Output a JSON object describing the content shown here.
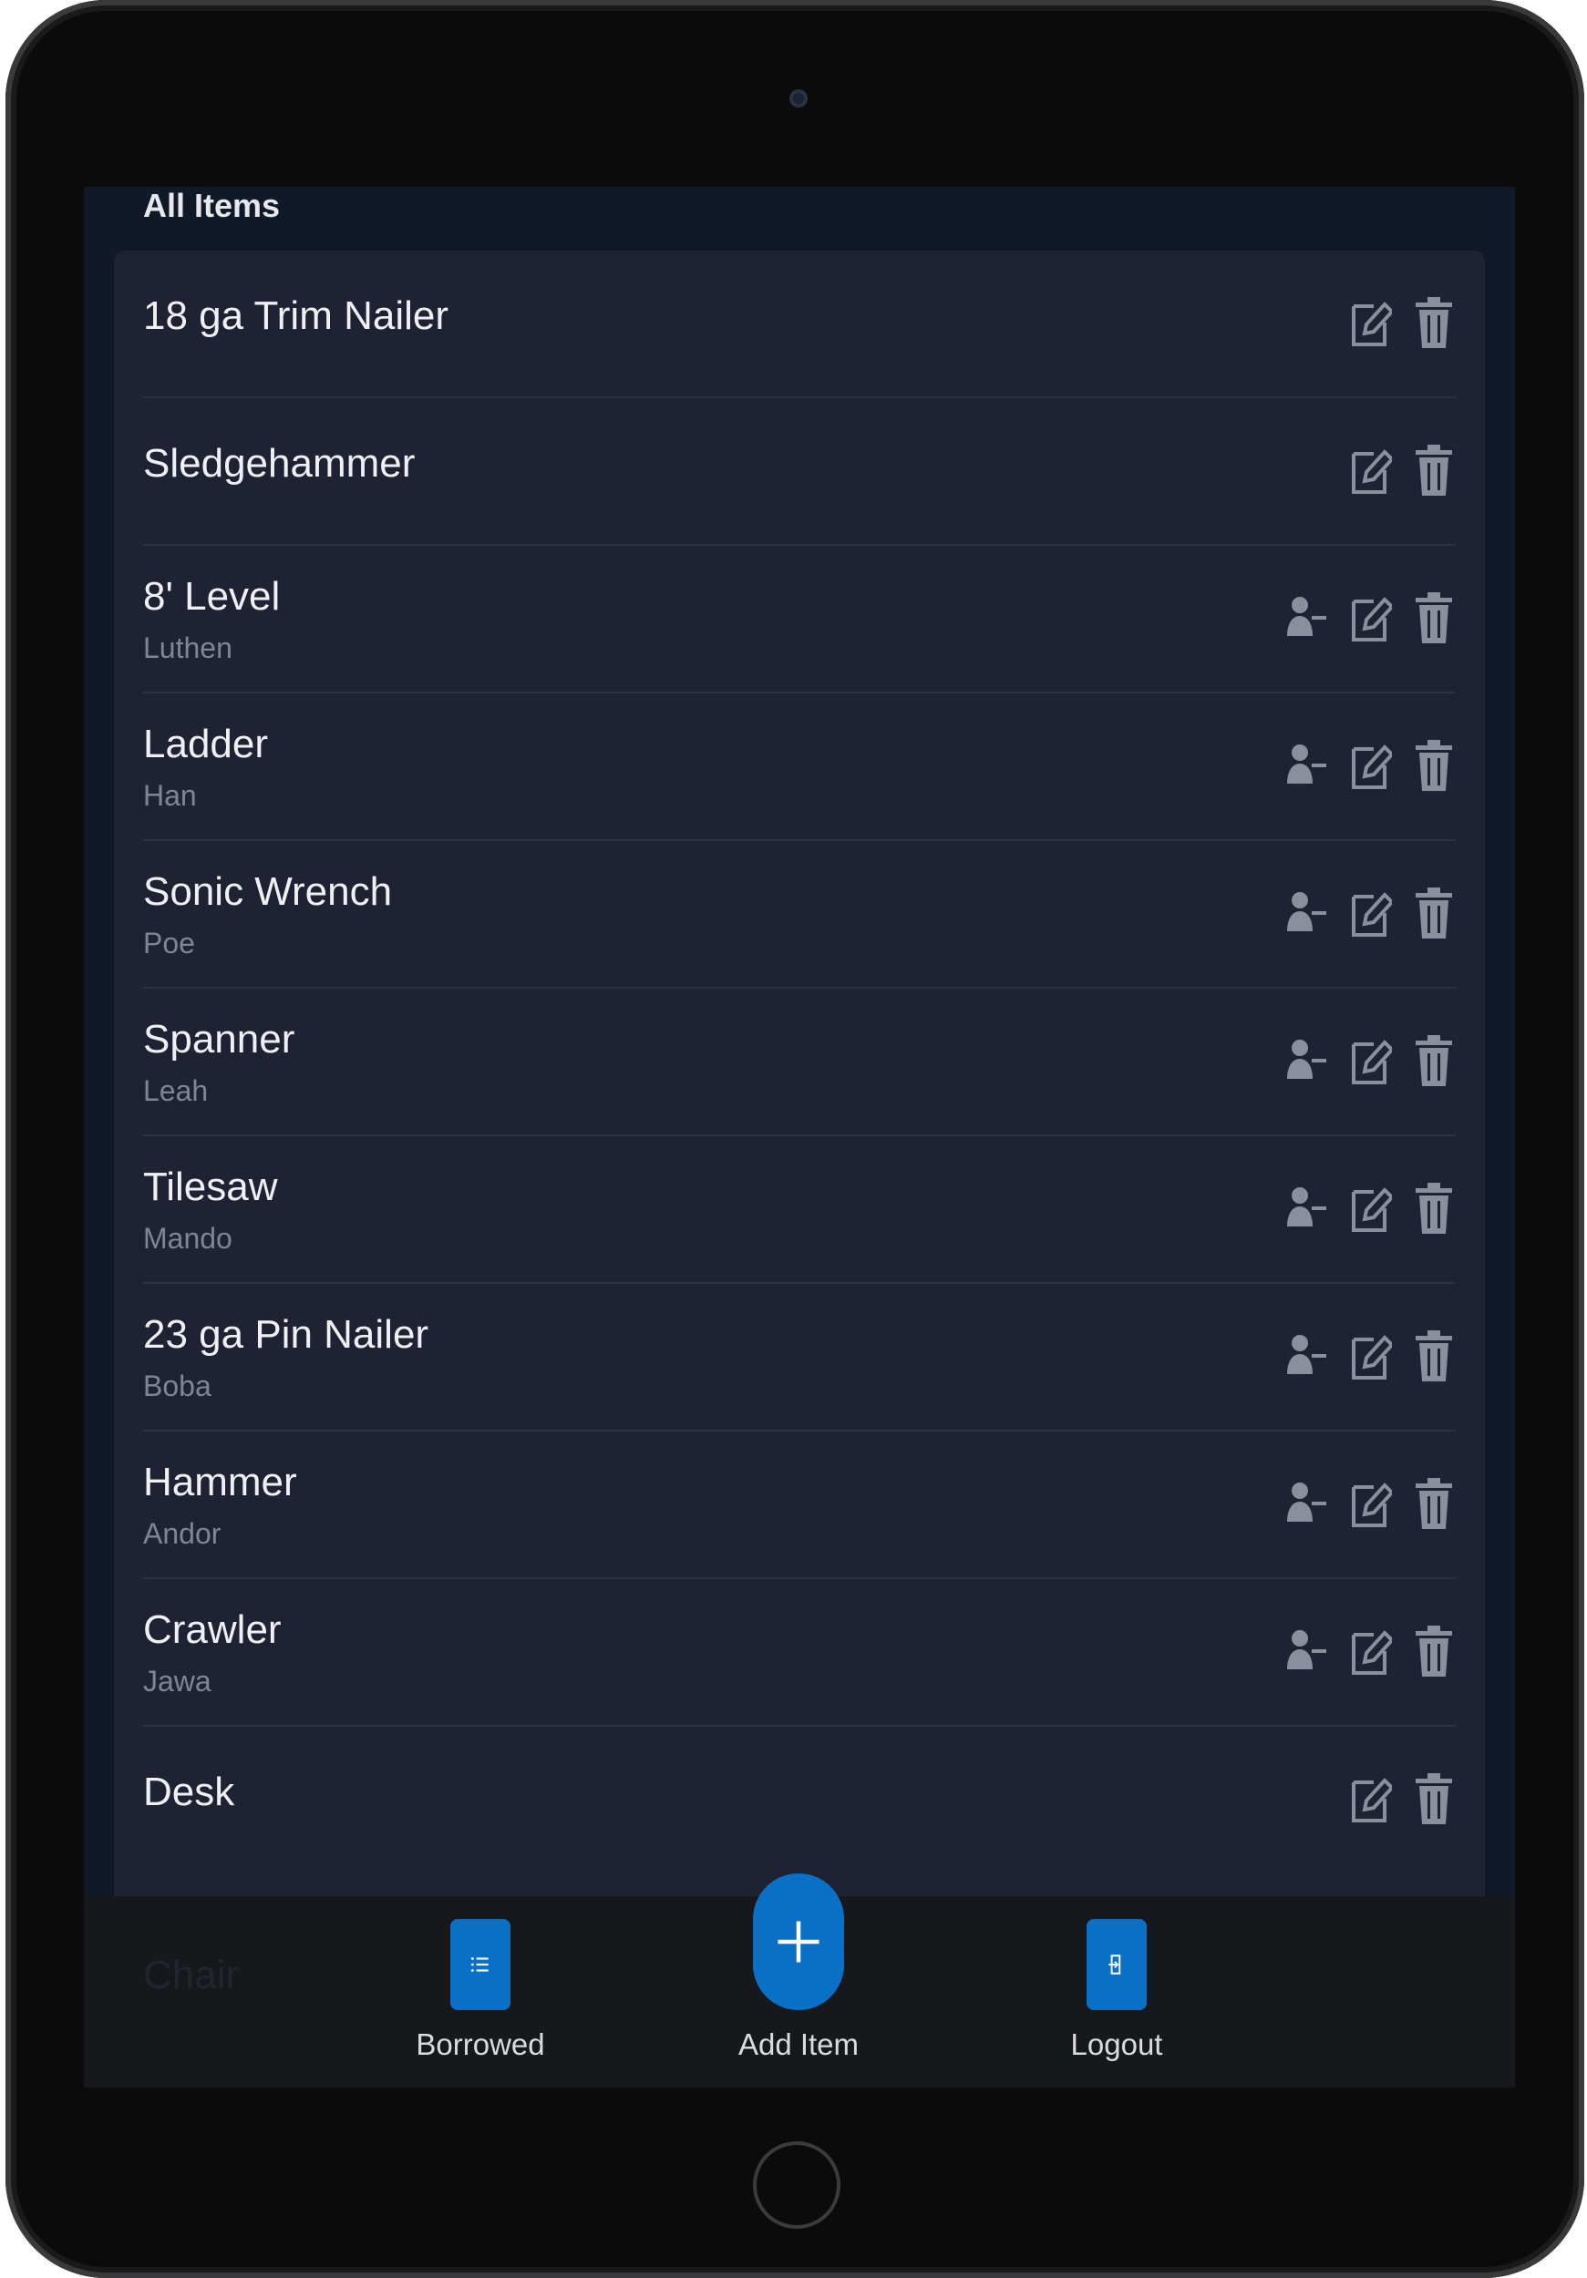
{
  "section": {
    "title": "All Items"
  },
  "items": [
    {
      "name": "18 ga Trim Nailer",
      "borrower": ""
    },
    {
      "name": "Sledgehammer",
      "borrower": ""
    },
    {
      "name": "8' Level",
      "borrower": "Luthen"
    },
    {
      "name": "Ladder",
      "borrower": "Han"
    },
    {
      "name": "Sonic Wrench",
      "borrower": "Poe"
    },
    {
      "name": "Spanner",
      "borrower": "Leah"
    },
    {
      "name": "Tilesaw",
      "borrower": "Mando"
    },
    {
      "name": "23 ga Pin Nailer",
      "borrower": "Boba"
    },
    {
      "name": "Hammer",
      "borrower": "Andor"
    },
    {
      "name": "Crawler",
      "borrower": "Jawa"
    },
    {
      "name": "Desk",
      "borrower": ""
    }
  ],
  "tabs": {
    "borrowed": {
      "label": "Borrowed",
      "icon": "list-icon"
    },
    "add_item": {
      "label": "Add Item",
      "icon": "plus-icon"
    },
    "logout": {
      "label": "Logout",
      "icon": "logout-icon"
    }
  },
  "ghost_row": {
    "name": "Chair"
  },
  "colors": {
    "accent": "#0a70c6",
    "background": "#111827",
    "card": "#1e2232",
    "icon": "#8a8f9b"
  },
  "row_icons": [
    "return-person-icon",
    "edit-icon",
    "trash-icon"
  ]
}
